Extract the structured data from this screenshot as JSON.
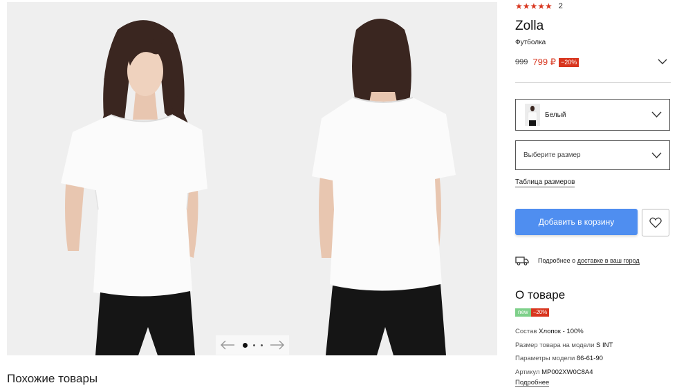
{
  "gallery": {
    "photos": [
      {
        "alt": "front-view"
      },
      {
        "alt": "back-view"
      }
    ],
    "pager": {
      "total": 3,
      "active": 1
    }
  },
  "similar": {
    "title": "Похожие товары"
  },
  "product": {
    "rating": {
      "stars": "★★★★★",
      "count": "2"
    },
    "brand": "Zolla",
    "category": "Футболка",
    "price": {
      "old": "999",
      "new": "799 ₽",
      "discount": "−20%"
    },
    "color_select": {
      "value": "Белый"
    },
    "size_select": {
      "placeholder": "Выберите размер"
    },
    "size_table_link": "Таблица размеров",
    "add_to_cart": "Добавить в корзину",
    "delivery": {
      "prefix": "Подробнее о ",
      "link": "доставке в ваш город"
    }
  },
  "about": {
    "title": "О товаре",
    "badges": {
      "new": "new",
      "discount": "−20%"
    },
    "specs": [
      {
        "label": "Состав ",
        "value": "Хлопок - 100%"
      },
      {
        "label": "Размер товара на модели ",
        "value": "S INT"
      },
      {
        "label": "Параметры модели ",
        "value": "86-61-90"
      },
      {
        "label": "Артикул ",
        "value": "MP002XW0C8A4"
      }
    ],
    "more_link": "Подробнее"
  },
  "colors": {
    "accent": "#4f8ef0",
    "sale": "#d8351e",
    "new_badge": "#7ed08a"
  },
  "icons": {
    "pager_prev": "arrow-left-icon",
    "pager_next": "arrow-right-icon",
    "chevron": "chevron-down-icon",
    "favorite": "heart-icon",
    "delivery": "truck-icon"
  }
}
